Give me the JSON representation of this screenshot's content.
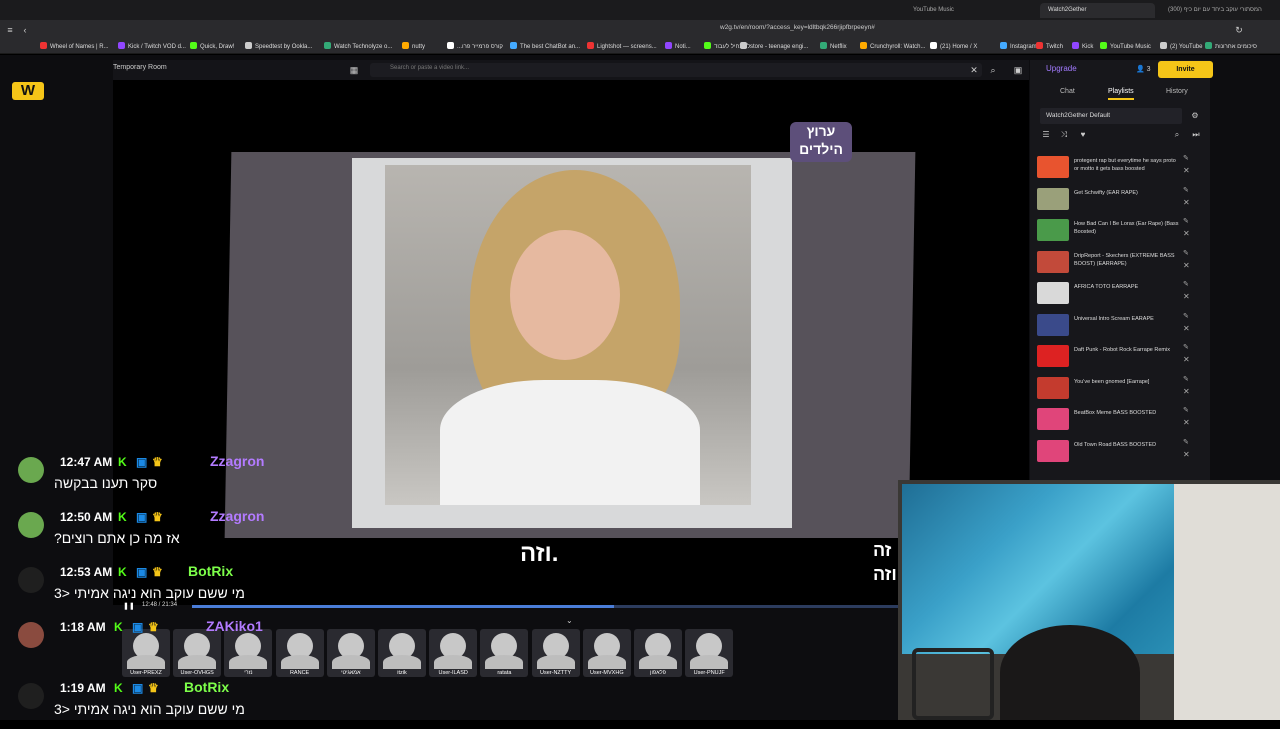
{
  "browser": {
    "tabs": [
      "YouTube Music",
      "Watch2Gether",
      "(300) המסתורי עוקב ביחד עם יום כיף"
    ],
    "url": "w2g.tv/en/room/?access_key=ldltbqk266rjipfbrpeeyn#",
    "bookmarks": [
      "Wheel of Names | R...",
      "Kick / Twitch VOD d...",
      "Quick, Draw!",
      "Speedtest by Ookla...",
      "Watch Technolyze o...",
      "nutty",
      "...קורס פרמייר פרו",
      "The best ChatBot an...",
      "Lightshot — screens...",
      "Noti...",
      "להתחיל לעבוד",
      "store - teenage engi...",
      "Netflix",
      "Crunchyroll: Watch...",
      "(21) Home / X",
      "Instagram",
      "Twitch",
      "Kick",
      "YouTube Music",
      "(2) YouTube",
      "סיכומים אחרונות"
    ]
  },
  "room": {
    "title": "Temporary Room",
    "search_placeholder": "Search or paste a video link...",
    "logo": "W"
  },
  "player": {
    "watermark": "ערוץ הילדים",
    "subtitle": "וזה.",
    "subtitle_right": "זה\nוזה",
    "timecode": "12:48 / 21:34",
    "progress_fraction": 0.596
  },
  "users": [
    "User-PREXZ",
    "User-OVHGS",
    "נזרי",
    "RANCE",
    "אמאגיטי",
    "itzik",
    "User-ILASD",
    "ratata",
    "User-NZTTY",
    "User-MVXHG",
    "פלאפון",
    "User-PNUJF"
  ],
  "chat": [
    {
      "time": "12:47 AM",
      "name": "Zzagron",
      "name_color": "#b37bff",
      "message": "סקר תענו בבקשה",
      "avatar_color": "#6aa84f"
    },
    {
      "time": "12:50 AM",
      "name": "Zzagron",
      "name_color": "#b37bff",
      "message": "?אז מה כן אתם רוצים",
      "avatar_color": "#6aa84f"
    },
    {
      "time": "12:53 AM",
      "name": "BotRix",
      "name_color": "#7dff4a",
      "message": "מי ששם עוקב הוא ניגה אמיתי <3",
      "avatar_color": "#1f1f1f"
    },
    {
      "time": "1:18 AM",
      "name": "ZAKiko1",
      "name_color": "#b37bff",
      "message": "",
      "avatar_color": "#8a4b3f"
    },
    {
      "time": "1:19 AM",
      "name": "BotRix",
      "name_color": "#7dff4a",
      "message": "מי ששם עוקב הוא ניגה אמיתי <3",
      "avatar_color": "#1f1f1f"
    }
  ],
  "chat_badge": "K",
  "sidebar": {
    "upgrade": "Upgrade",
    "user_count": "3",
    "invite": "Invite",
    "tabs": [
      "Chat",
      "Playlists",
      "History"
    ],
    "playlist_name": "Watch2Gether Default",
    "items": [
      {
        "title": "protegent rap but everytime he says proto or motto it gets bass boosted",
        "color": "#e8542f"
      },
      {
        "title": "Get Schwifty (EAR RAPE)",
        "color": "#9aa07a"
      },
      {
        "title": "How Bad Can I Be Lorax (Ear Rape) (Bass Boosted)",
        "color": "#4a9a4a"
      },
      {
        "title": "DripReport - Skechers (EXTREME BASS BOOST) (EARRAPE)",
        "color": "#c24a3a"
      },
      {
        "title": "AFRICA TOTO EARRAPE",
        "color": "#d9d9d9"
      },
      {
        "title": "Universal Intro Scream EARAPE",
        "color": "#3a4a8a"
      },
      {
        "title": "Daft Punk - Robot Rock Earrape Remix",
        "color": "#d22"
      },
      {
        "title": "You've been gnomed [Earrape]",
        "color": "#c43b2e"
      },
      {
        "title": "BeatBox Meme BASS BOOSTED",
        "color": "#e0457a"
      },
      {
        "title": "Old Town Road BASS BOOSTED",
        "color": "#e0457a"
      }
    ]
  },
  "colors": {
    "accent": "#f5c518",
    "progress": "#4a7dd8",
    "upgrade": "#a37bff"
  }
}
